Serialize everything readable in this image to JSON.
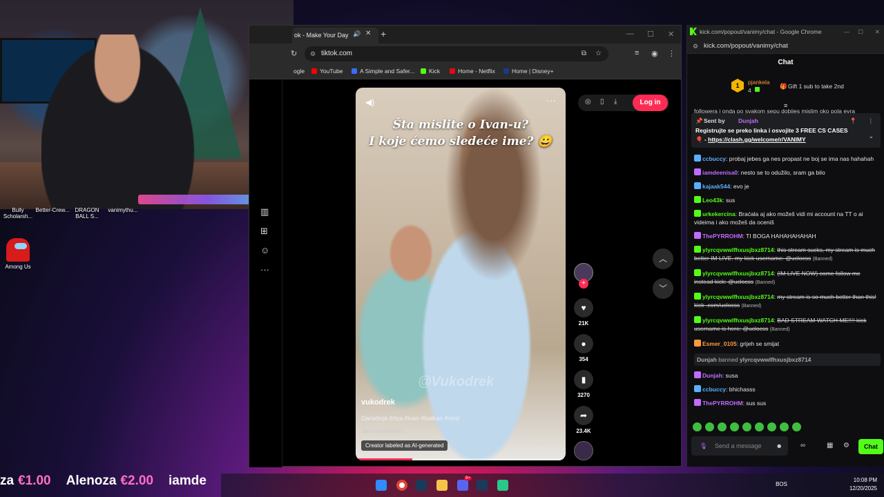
{
  "colors": {
    "tiktok_red": "#fe2c55",
    "kick_green": "#53fc18",
    "username_green": "#53fc18",
    "username_blue": "#5ab0ff",
    "username_purple": "#c06cff",
    "username_orange": "#ff9a3c"
  },
  "desktop": {
    "icons": [
      "Bully Scholarsh...",
      "Better-Crew...",
      "DRAGON BALL S...",
      "vanimythu...",
      "Among Us"
    ]
  },
  "tiktok": {
    "tab_title": "ok - Make Your Day",
    "url": "tiktok.com",
    "bookmarks": [
      "ogle",
      "YouTube",
      "A Simple and Safer...",
      "Kick",
      "Home - Netflix",
      "Home | Disney+"
    ],
    "login_label": "Log in",
    "video": {
      "caption_line1": "Šta mislite o Ivan-u?",
      "caption_line2": "I koje ćemo sledeće ime? 😀",
      "watermark": "@Vukodrek",
      "author": "vukodrek",
      "description": "Današnja žrtva #ivan #balkan #viral",
      "see_translation": "See translation",
      "ai_label": "Creator labeled as AI-generated",
      "progress": 0.27
    },
    "actions": {
      "likes": "21K",
      "comments": "354",
      "saves": "3270",
      "shares": "23.4K"
    }
  },
  "kick": {
    "window_title": "kick.com/popout/vanimy/chat - Google Chrome",
    "url": "kick.com/popout/vanimy/chat",
    "header": "Chat",
    "top_gifter": {
      "rank": "1",
      "name": "pjankela",
      "count": "4",
      "gift_text": "Gift 1 sub to take 2nd"
    },
    "overflow_line": "followera i onda po svakom sepu dobijes mislim oko pola evra",
    "pinned": {
      "sent_by_label": "Sent by",
      "sender": "Dunjah",
      "text": "Registrujte se preko linka i osvojite 3 FREE CS CASES",
      "link_prefix": "🎈 - ",
      "link": "https://clash.gg/welcome/r/VANIMY"
    },
    "messages": [
      {
        "user": "ccbuccy",
        "text": "probaj jebes ga nes propast ne boj se ima nas hahahah",
        "color": "#5ab0ff"
      },
      {
        "user": "iamdeenisa0",
        "text": "nesto se to odužilo, sram ga bilo",
        "color": "#c06cff"
      },
      {
        "user": "kajaak544",
        "text": "evo je",
        "color": "#5ab0ff"
      },
      {
        "user": "Leo43k",
        "text": "sus",
        "color": "#53fc18"
      },
      {
        "user": "urkekercina",
        "text": "Braćala aj ako možeš vidi mi account na TT o ai videima i ako možeš da oceniš",
        "color": "#53fc18"
      },
      {
        "user": "ThePYRROHM",
        "text": "TI BOGA HAHAHAHAHAH",
        "color": "#c06cff"
      },
      {
        "user": "ylyrcqvwwlfhxusjbxz8714",
        "text": "this stream sucks, my stream is much better IM LIVE. my kick username: @uclocss",
        "color": "#53fc18",
        "banned": "(Banned)"
      },
      {
        "user": "ylyrcqvwwlfhxusjbxz8714",
        "text": "(IM LIVE NOW) come follow me instead kick: @uclocss",
        "color": "#53fc18",
        "banned": "(Banned)"
      },
      {
        "user": "ylyrcqvwwlfhxusjbxz8714",
        "text": "my stream is so much better than this! kick .com/uclocss",
        "color": "#53fc18",
        "banned": "(Banned)"
      },
      {
        "user": "ylyrcqvwwlfhxusjbxz8714",
        "text": "BAD STREAM WATCH ME!!!! kick username is here: @uclocss",
        "color": "#53fc18",
        "banned": "(Banned)"
      },
      {
        "user": "Esmer_0105",
        "text": "grijeh se smijat",
        "color": "#ff9a3c"
      }
    ],
    "ban_notice": {
      "moderator": "Dunjah",
      "action": "banned",
      "target": "ylyrcqvwwlfhxusjbxz8714"
    },
    "messages_after": [
      {
        "user": "Dunjah",
        "text": "susa",
        "color": "#c06cff"
      },
      {
        "user": "ccbuccy",
        "text": "bhichasss",
        "color": "#5ab0ff"
      },
      {
        "user": "ThePYRROHM",
        "text": "sus sus",
        "color": "#c06cff"
      }
    ],
    "input_placeholder": "Send a message",
    "send_label": "Chat"
  },
  "ticker": [
    {
      "name": "za",
      "amount": "€1.00"
    },
    {
      "name": "Alenoza",
      "amount": "€2.00"
    },
    {
      "name": "iamde",
      "amount": ""
    }
  ],
  "taskbar": {
    "discord_badge": "9+",
    "lang": "BOS",
    "time": "10:08 PM",
    "date": "12/20/2025"
  }
}
